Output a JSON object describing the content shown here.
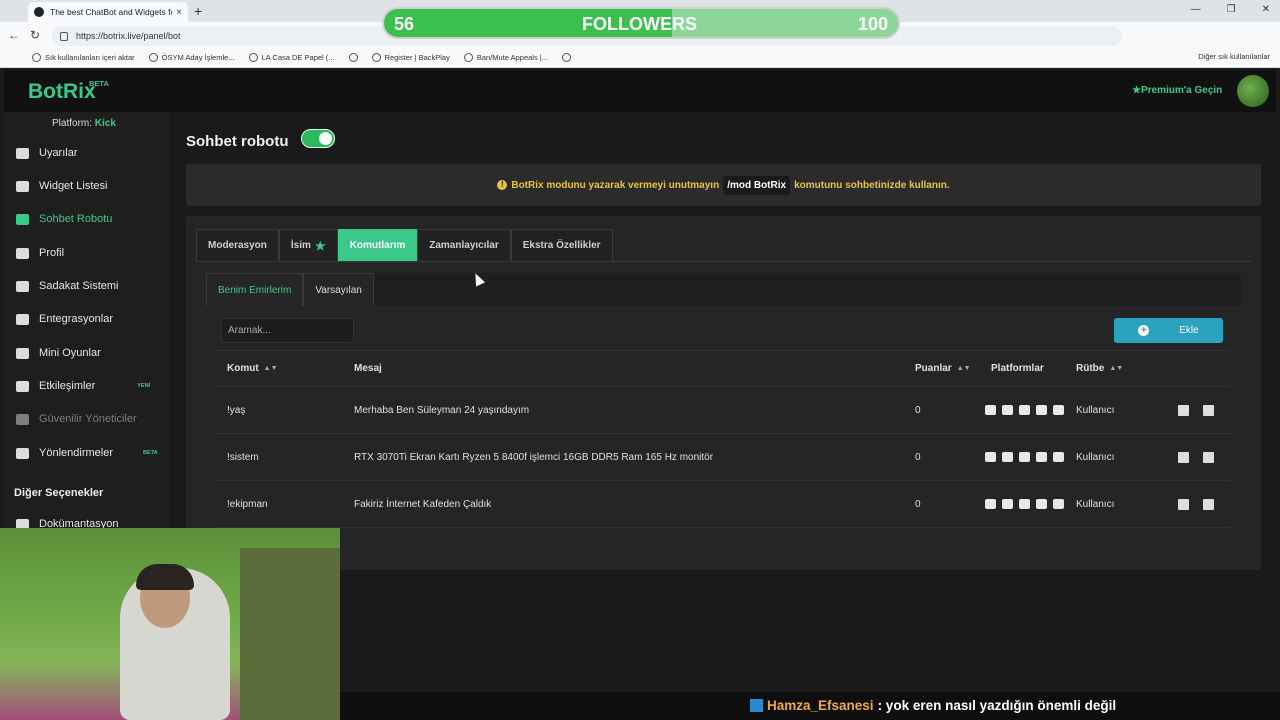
{
  "browser": {
    "tab_title": "The best ChatBot and Widgets fo",
    "url": "https://botrix.live/panel/bot",
    "bookmarks": [
      "Sık kullanılanları içeri aktar",
      "ÖSYM Aday İşlemle...",
      "LA Casa DE Papel (...",
      "",
      "Register | BackPlay",
      "Ban/Mute Appeals |...",
      ""
    ],
    "other_bookmarks": "Diğer sık kullanılanlar"
  },
  "overlay": {
    "followers_label": "FOLLOWERS",
    "current": "56",
    "goal": "100",
    "progress_fraction": 0.56,
    "chat_user": "Hamza_Efsanesi",
    "chat_text": ": yok eren nasıl yazdığın önemli değil"
  },
  "app": {
    "logo": "BotRix",
    "beta": "BETA",
    "premium": "★Premium'a Geçin",
    "platform_label": "Platform:",
    "platform_value": "Kick"
  },
  "sidebar": {
    "items": [
      {
        "label": "Uyarılar"
      },
      {
        "label": "Widget Listesi"
      },
      {
        "label": "Sohbet Robotu"
      },
      {
        "label": "Profil"
      },
      {
        "label": "Sadakat Sistemi"
      },
      {
        "label": "Entegrasyonlar"
      },
      {
        "label": "Mini Oyunlar"
      },
      {
        "label": "Etkileşimler",
        "tag": "YENİ"
      },
      {
        "label": "Güvenilir Yöneticiler"
      },
      {
        "label": "Yönlendirmeler",
        "tag": "BETA"
      },
      {
        "label": "Dokümantasyon"
      }
    ],
    "other_options": "Diğer Seçenekler"
  },
  "main": {
    "title": "Sohbet robotu",
    "notice_before": "BotRix modunu yazarak vermeyi unutmayın",
    "notice_code": "/mod BotRix",
    "notice_after": "komutunu sohbetinizde kullanın.",
    "tabs": [
      "Moderasyon",
      "İsim",
      "Komutlarım",
      "Zamanlayıcılar",
      "Ekstra Özellikler"
    ],
    "subtabs": [
      "Benim Emirlerim",
      "Varsayılan"
    ],
    "search_placeholder": "Aramak...",
    "add_label": "Ekle"
  },
  "table": {
    "headers": {
      "komut": "Komut",
      "mesaj": "Mesaj",
      "puanlar": "Puanlar",
      "platformlar": "Platformlar",
      "rutbe": "Rütbe"
    },
    "rows": [
      {
        "komut": "!yaş",
        "mesaj": "Merhaba Ben Süleyman 24 yaşındayım",
        "puanlar": "0",
        "rutbe": "Kullanıcı"
      },
      {
        "komut": "!sistem",
        "mesaj": "RTX 3070Ti Ekran Kartı Ryzen 5 8400f işlemci 16GB DDR5 Ram 165 Hz monitör",
        "puanlar": "0",
        "rutbe": "Kullanıcı"
      },
      {
        "komut": "!ekipman",
        "mesaj": "Fakiriz İnternet Kafeden Çaldık",
        "puanlar": "0",
        "rutbe": "Kullanıcı"
      }
    ]
  }
}
